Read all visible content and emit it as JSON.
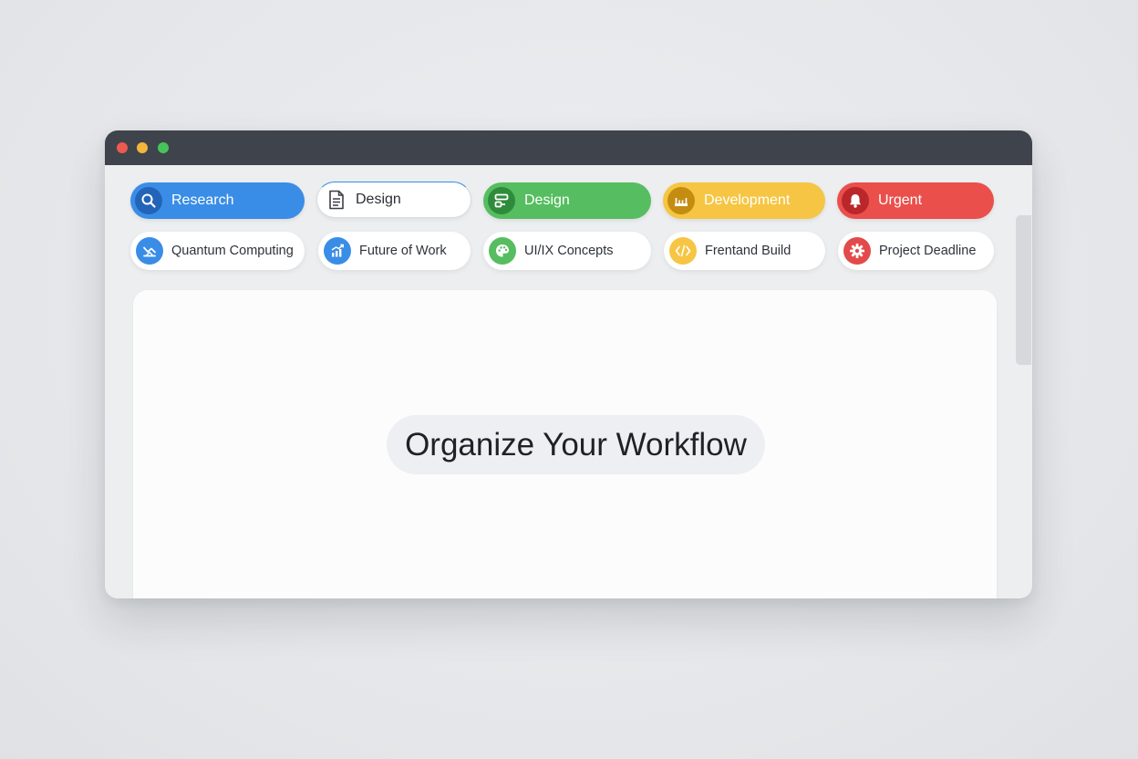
{
  "window": {
    "controls": [
      "close",
      "minimize",
      "maximize"
    ]
  },
  "category_tags": [
    {
      "label": "Research",
      "color": "#3a8de6",
      "icon": "search-icon"
    },
    {
      "label": "Design",
      "color": "#ffffff",
      "icon": "document-icon"
    },
    {
      "label": "Design",
      "color": "#56bd60",
      "icon": "shapes-icon"
    },
    {
      "label": "Development",
      "color": "#f6c543",
      "icon": "ruler-icon"
    },
    {
      "label": "Urgent",
      "color": "#ea4f4c",
      "icon": "bell-icon"
    }
  ],
  "topic_chips": [
    {
      "label": "Quantum Computing",
      "icon_color": "#3a8de6",
      "icon": "satellite-icon"
    },
    {
      "label": "Future of Work",
      "icon_color": "#3a8de6",
      "icon": "growth-chart-icon"
    },
    {
      "label": "UI/IX Concepts",
      "icon_color": "#56bd60",
      "icon": "palette-icon"
    },
    {
      "label": "Frentand Build",
      "icon_color": "#f6c543",
      "icon": "code-icon"
    },
    {
      "label": "Project Deadline",
      "icon_color": "#e24b4a",
      "icon": "gear-icon"
    }
  ],
  "main": {
    "headline": "Organize Your Workflow"
  }
}
